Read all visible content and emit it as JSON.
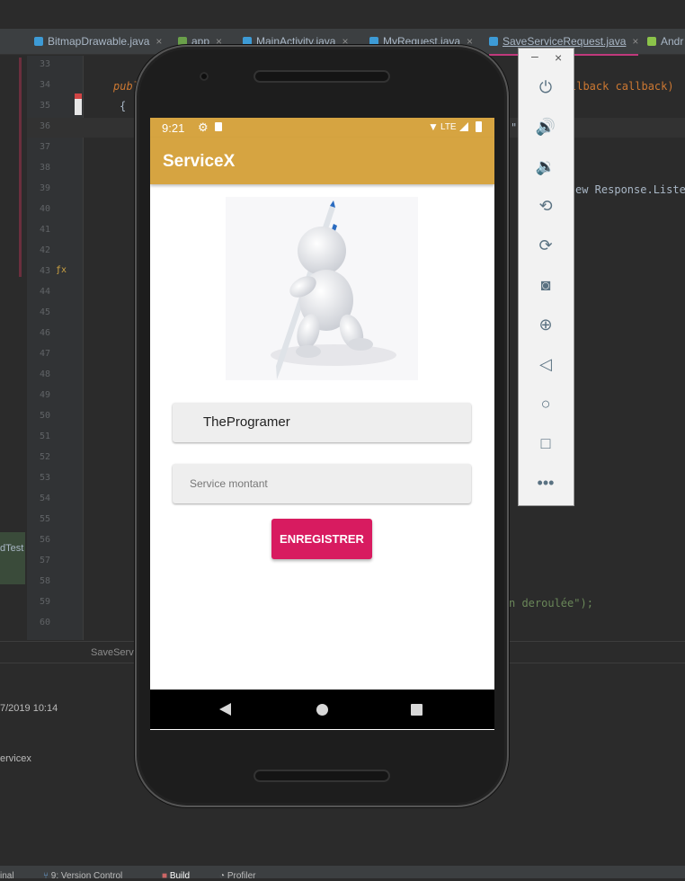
{
  "ide": {
    "tabs": [
      {
        "label": "BitmapDrawable.java"
      },
      {
        "label": "app"
      },
      {
        "label": "MainActivity.java"
      },
      {
        "label": "MyRequest.java"
      },
      {
        "label": "SaveServiceRequest.java"
      },
      {
        "label": "Andr"
      }
    ],
    "tab_close": "×",
    "line_numbers": [
      "33",
      "34",
      "35",
      "36",
      "37",
      "38",
      "39",
      "40",
      "41",
      "42",
      "43",
      "44",
      "45",
      "46",
      "47",
      "48",
      "49",
      "50",
      "51",
      "52",
      "53",
      "54",
      "55",
      "56",
      "57",
      "58",
      "59",
      "60"
    ],
    "code": {
      "line34_left": "publ",
      "line34_right": "llback callback)",
      "line35": "{",
      "line39_right": "ew Response.Listen",
      "line59_right": "n deroulée\");",
      "line36_mark": "\""
    },
    "fx_marker": "ƒx",
    "breadcrumb": "SaveServi",
    "side_label": "dTest",
    "log_time": "7/2019 10:14",
    "log_project": "ervicex",
    "bottom_tabs": [
      "inal",
      "9: Version Control",
      "Build",
      "Profiler"
    ]
  },
  "device": {
    "status_time": "9:21",
    "status_lte": "LTE",
    "app_title": "ServiceX",
    "name_field_value": "TheProgramer",
    "amount_field_placeholder": "Service montant",
    "save_button_label": "ENREGISTRER"
  },
  "emulator_controls": {
    "minimize": "–",
    "close": "×",
    "buttons": [
      "power-icon",
      "volume-up-icon",
      "volume-down-icon",
      "rotate-left-icon",
      "rotate-right-icon",
      "camera-icon",
      "zoom-icon",
      "back-icon",
      "home-icon",
      "overview-icon",
      "more-icon"
    ]
  },
  "colors": {
    "app_bar": "#d6a441",
    "accent_button": "#d81b60",
    "ide_background": "#2b2b2b"
  }
}
